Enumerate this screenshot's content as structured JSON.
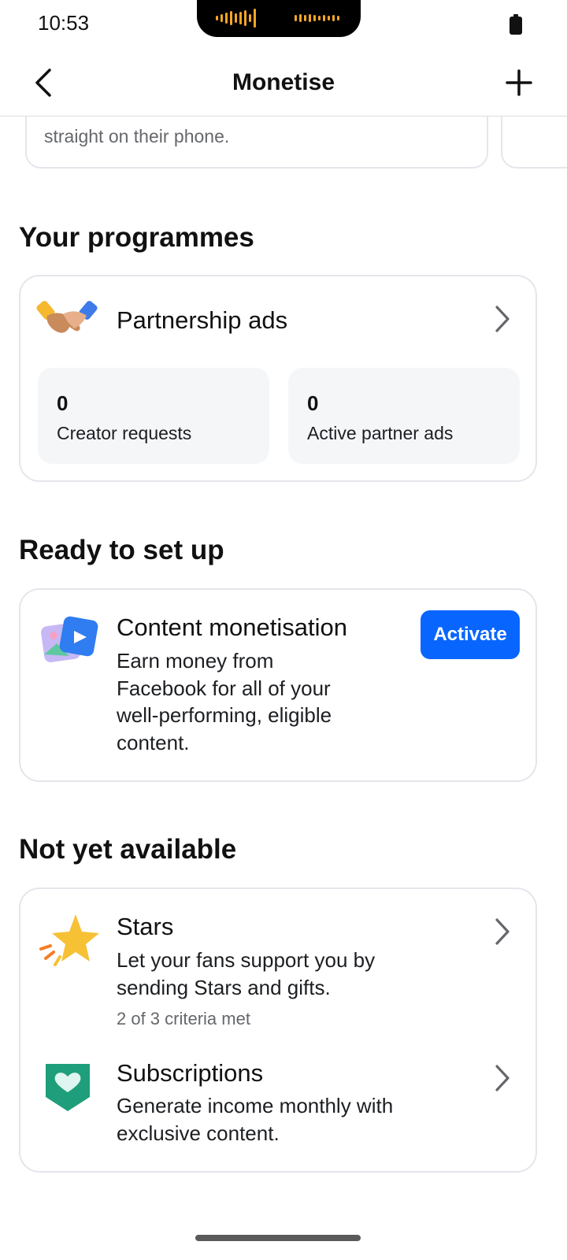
{
  "status_bar": {
    "time": "10:53",
    "battery_icon": "battery-full-icon"
  },
  "header": {
    "title": "Monetise",
    "back_icon": "chevron-left-icon",
    "add_icon": "plus-icon"
  },
  "carousel": {
    "partial_text": "straight on their phone."
  },
  "sections": {
    "your_programmes": {
      "title": "Your programmes",
      "partnership": {
        "icon": "handshake-icon",
        "title": "Partnership ads",
        "stats": [
          {
            "value": "0",
            "label": "Creator requests"
          },
          {
            "value": "0",
            "label": "Active partner ads"
          }
        ]
      }
    },
    "ready": {
      "title": "Ready to set up",
      "content_monetisation": {
        "icon": "video-photo-icon",
        "title": "Content monetisation",
        "description_lines": [
          "Earn money from",
          "Facebook for all of your",
          "well-performing, eligible",
          "content."
        ],
        "action_label": "Activate"
      }
    },
    "not_available": {
      "title": "Not yet available",
      "stars": {
        "icon": "star-icon",
        "title": "Stars",
        "description_lines": [
          "Let your fans support you by",
          "sending Stars and gifts."
        ],
        "criteria": "2 of 3 criteria met"
      },
      "subscriptions": {
        "icon": "heart-badge-icon",
        "title": "Subscriptions",
        "description_lines": [
          "Generate income monthly with",
          "exclusive content."
        ]
      }
    }
  },
  "colors": {
    "accent": "#0866ff",
    "card_border": "#e4e6eb",
    "stat_background": "#f5f6f8",
    "secondary_text": "#65676b"
  }
}
